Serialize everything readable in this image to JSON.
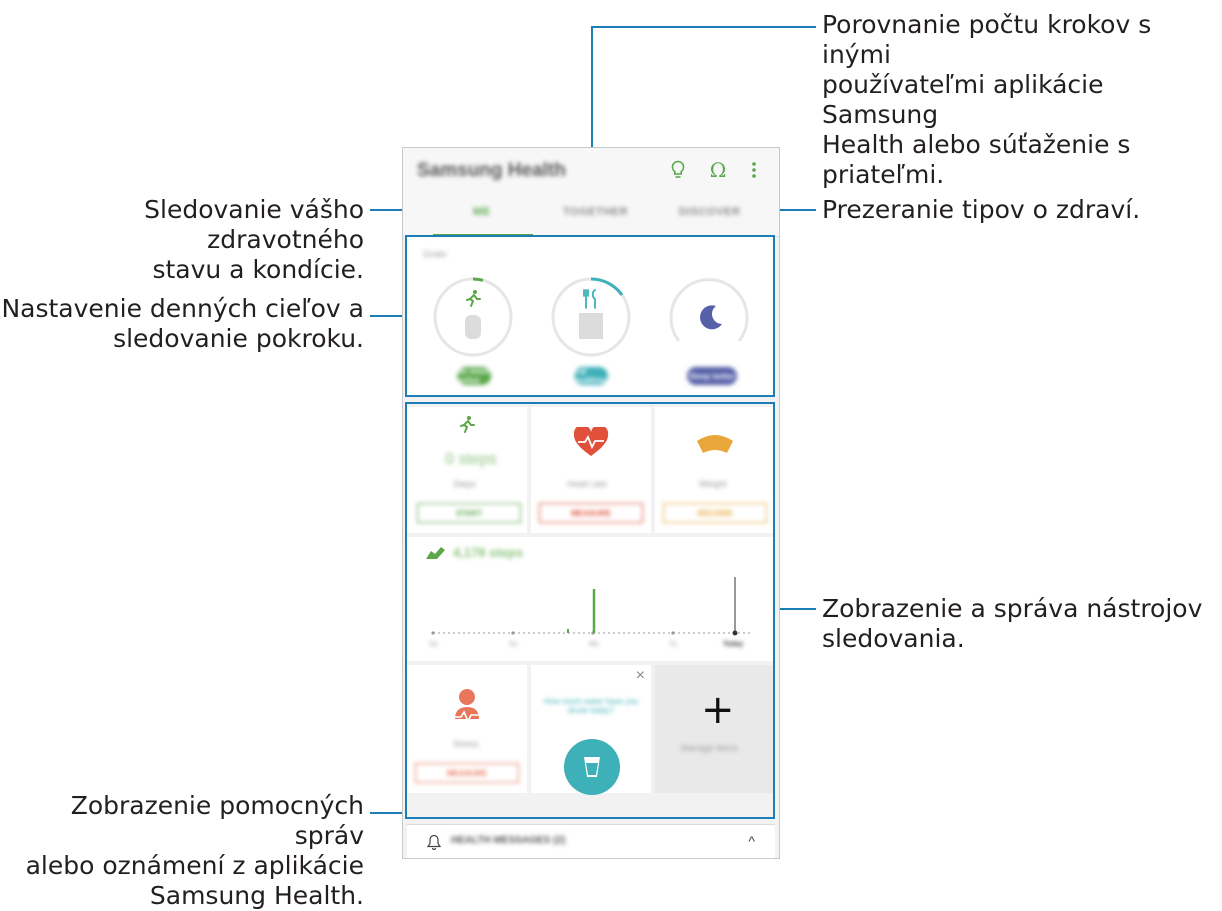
{
  "callouts": {
    "top_right": "Porovnanie počtu krokov s inými\npoužívateľmi aplikácie Samsung\nHealth alebo súťaženie s priateľmi.",
    "tabs_left": "Sledovanie vášho zdravotného\nstavu a kondície.",
    "tips_right": "Prezeranie tipov o zdraví.",
    "goals_left": "Nastavenie denných cieľov a\nsledovanie pokroku.",
    "trackers_right": "Zobrazenie a správa nástrojov\nsledovania.",
    "messages_left": "Zobrazenie pomocných správ\nalebo oznámení z aplikácie\nSamsung Health."
  },
  "app": {
    "title": "Samsung Health",
    "tabs": [
      "ME",
      "TOGETHER",
      "DISCOVER"
    ],
    "goals_label": "Goals",
    "goal_buttons": [
      "Be more active",
      "Eat healthier",
      "Sleep better"
    ],
    "tiles": [
      {
        "label": "Steps",
        "value": "0 steps",
        "button": "START"
      },
      {
        "label": "Heart rate",
        "button": "MEASURE"
      },
      {
        "label": "Weight",
        "button": "RECORD"
      }
    ],
    "steps_total": "4,178 steps",
    "axis_ticks": [
      "Sa",
      "Su",
      "Mo",
      "Tu",
      "Today"
    ],
    "stress": {
      "label": "Stress",
      "button": "MEASURE"
    },
    "water_prompt": "How much water have you drunk today?",
    "manage_items": "Manage items",
    "messages": "HEALTH MESSAGES (2)",
    "plus": "+",
    "close": "×",
    "chevron": "^"
  },
  "colors": {
    "leader": "#1b7fb5",
    "green": "#5aa84a",
    "teal": "#3db0b8",
    "indigo": "#5560a8",
    "red": "#e0503a",
    "orange": "#e9a63a",
    "salmon": "#e8765a"
  },
  "icons": [
    "bulb-icon",
    "omega-icon",
    "more-icon",
    "runner-icon",
    "fork-knife-icon",
    "moon-icon",
    "heart-icon",
    "scale-icon",
    "shoe-icon",
    "person-icon",
    "cup-icon",
    "bell-icon",
    "close-icon",
    "chevron-up-icon"
  ]
}
